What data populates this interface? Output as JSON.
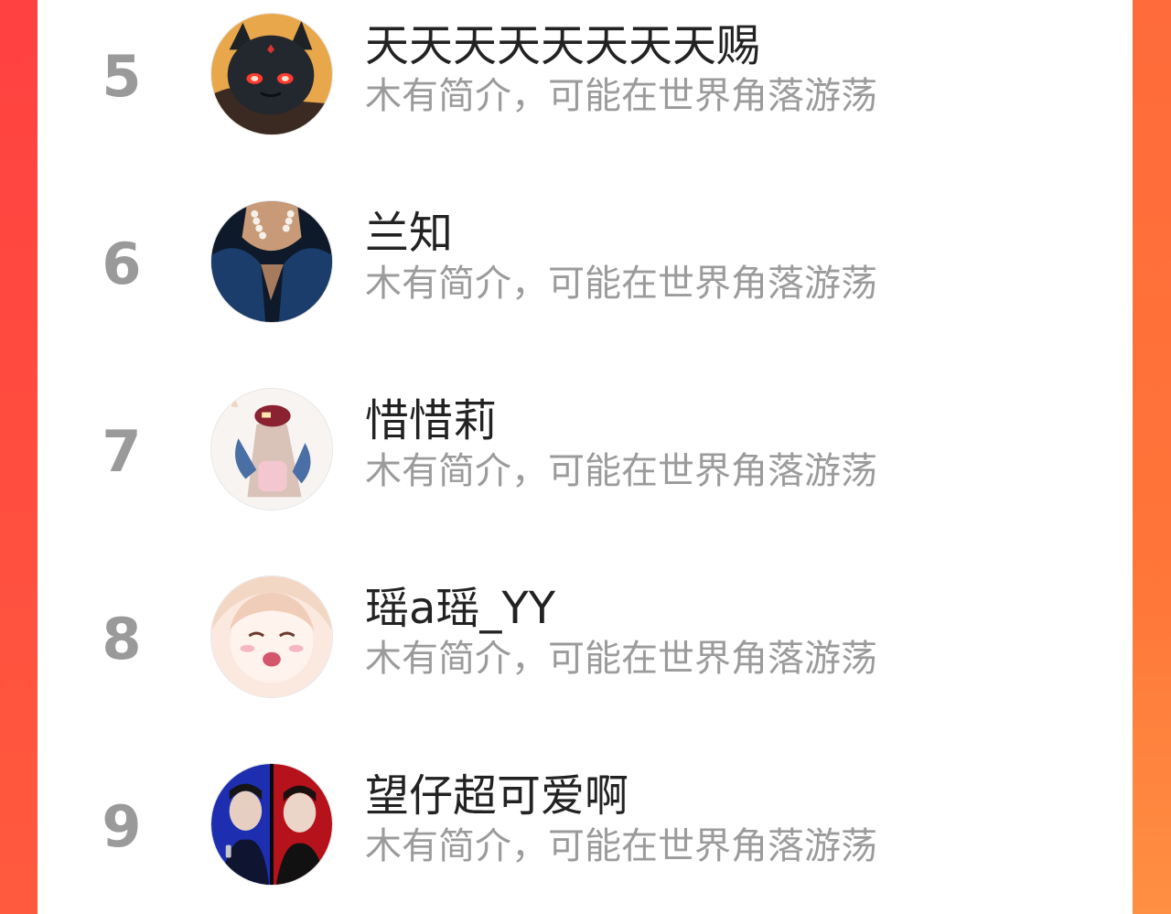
{
  "ranking": {
    "items": [
      {
        "rank": "5",
        "name": "天天天天天天天天赐",
        "bio": "木有简介，可能在世界角落游荡",
        "avatar": "dark-demon-cat-avatar"
      },
      {
        "rank": "6",
        "name": "兰知",
        "bio": "木有简介，可能在世界角落游荡",
        "avatar": "pearl-necklace-avatar"
      },
      {
        "rank": "7",
        "name": "惜惜莉",
        "bio": "木有简介，可能在世界角落游荡",
        "avatar": "girl-with-cap-avatar"
      },
      {
        "rank": "8",
        "name": "瑶a瑶_YY",
        "bio": "木有简介，可能在世界角落游荡",
        "avatar": "anime-girl-avatar"
      },
      {
        "rank": "9",
        "name": "望仔超可爱啊",
        "bio": "木有简介，可能在世界角落游荡",
        "avatar": "singer-split-avatar"
      }
    ]
  },
  "colors": {
    "rank": "#9a9a9a",
    "name": "#222222",
    "bio": "#9b9b9b",
    "side_left": "#ff4a44",
    "side_right": "#ff7a3a"
  }
}
